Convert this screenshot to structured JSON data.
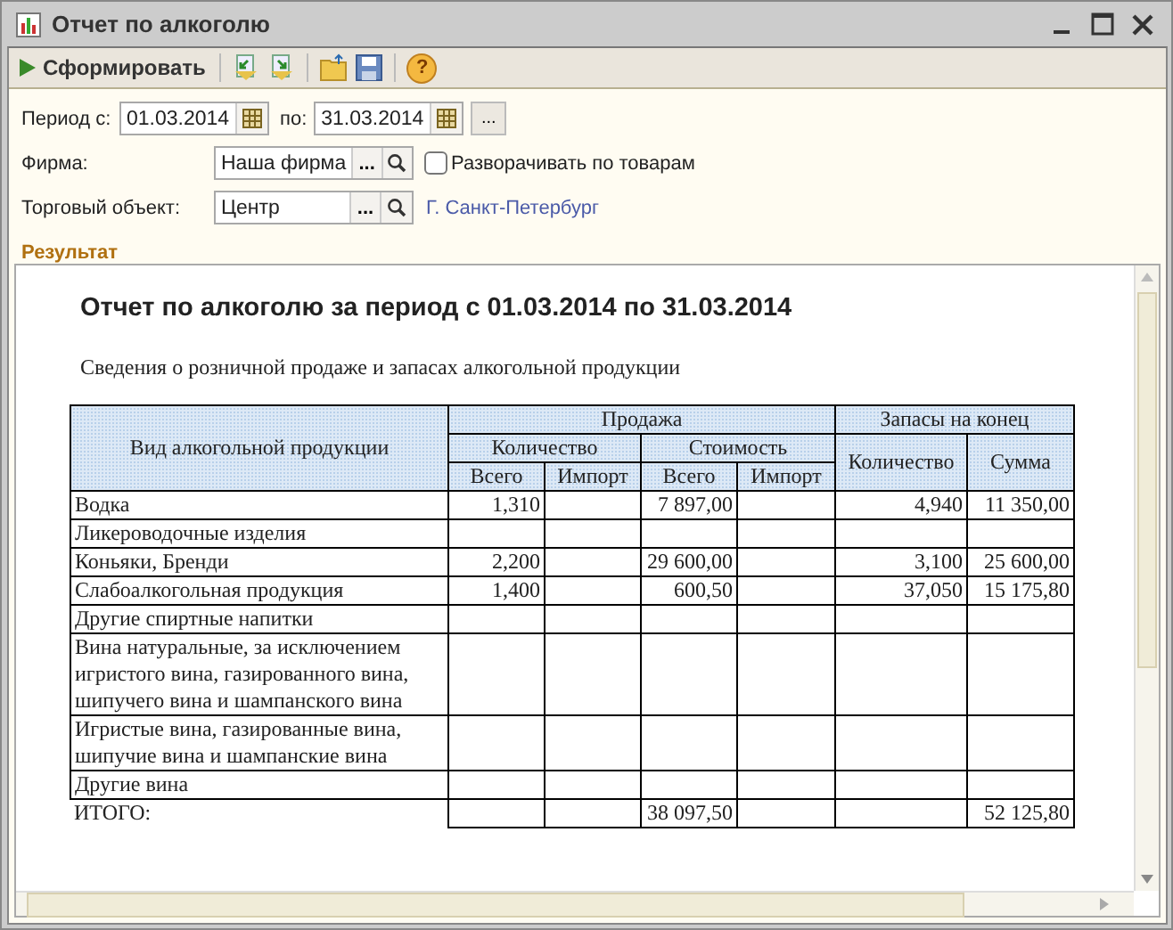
{
  "window": {
    "title": "Отчет по алкоголю"
  },
  "toolbar": {
    "run_label": "Сформировать",
    "help_label": "?"
  },
  "form": {
    "period_from_label": "Период с:",
    "period_from": "01.03.2014",
    "period_to_label": "по:",
    "period_to": "31.03.2014",
    "period_choose": "...",
    "firm_label": "Фирма:",
    "firm": "Наша фирма",
    "firm_choose": "...",
    "expand_label": "Разворачивать по товарам",
    "expand_checked": false,
    "object_label": "Торговый объект:",
    "object": "Центр",
    "object_choose": "...",
    "object_link": "Г. Санкт-Петербург"
  },
  "result_label": "Результат",
  "report": {
    "title": "Отчет по алкоголю за период с 01.03.2014 по 31.03.2014",
    "subtitle": "Сведения о розничной продаже и запасах алкогольной продукции",
    "header": {
      "name": "Вид алкогольной продукции",
      "sale": "Продажа",
      "stock": "Запасы на конец",
      "qty": "Количество",
      "cost": "Стоимость",
      "qty_total": "Всего",
      "qty_import": "Импорт",
      "cost_total": "Всего",
      "cost_import": "Импорт",
      "stock_qty": "Количество",
      "stock_sum": "Сумма"
    },
    "rows": [
      {
        "kind": "item",
        "name": "Водка",
        "qty_total": "1,310",
        "cost_total": "7 897,00",
        "stock_qty": "4,940",
        "stock_sum": "11 350,00"
      },
      {
        "kind": "item",
        "name": "Ликероводочные изделия"
      },
      {
        "kind": "item",
        "name": "Коньяки, Бренди",
        "qty_total": "2,200",
        "cost_total": "29 600,00",
        "stock_qty": "3,100",
        "stock_sum": "25 600,00"
      },
      {
        "kind": "item",
        "name": "Слабоалкогольная продукция",
        "qty_total": "1,400",
        "cost_total": "600,50",
        "stock_qty": "37,050",
        "stock_sum": "15 175,80"
      },
      {
        "kind": "item",
        "name": "Другие спиртные напитки"
      },
      {
        "kind": "item",
        "name": "Вина натуральные, за исключением игристого вина, газированного вина, шипучего вина и шампанского вина"
      },
      {
        "kind": "item",
        "name": "Игристые вина, газированные вина, шипучие вина и шампанские вина"
      },
      {
        "kind": "item",
        "name": "Другие вина"
      },
      {
        "kind": "total",
        "name": "ИТОГО:",
        "cost_total": "38 097,50",
        "stock_sum": "52 125,80"
      }
    ]
  }
}
